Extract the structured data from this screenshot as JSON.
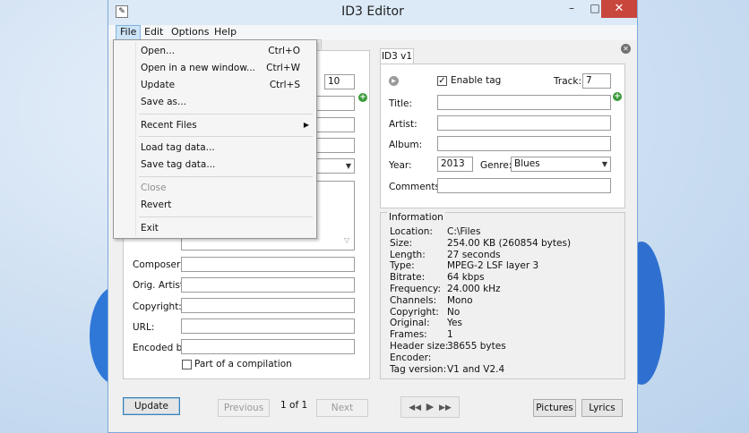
{
  "window": {
    "title": "ID3 Editor"
  },
  "menubar": {
    "file": "File",
    "edit": "Edit",
    "options": "Options",
    "help": "Help"
  },
  "file_menu": {
    "open": {
      "label": "Open...",
      "shortcut": "Ctrl+O"
    },
    "open_new_window": {
      "label": "Open in a new window...",
      "shortcut": "Ctrl+W"
    },
    "update": {
      "label": "Update",
      "shortcut": "Ctrl+S"
    },
    "save_as": {
      "label": "Save as..."
    },
    "recent_files": {
      "label": "Recent Files"
    },
    "load_tag": {
      "label": "Load tag data..."
    },
    "save_tag": {
      "label": "Save tag data..."
    },
    "close": {
      "label": "Close"
    },
    "revert": {
      "label": "Revert"
    },
    "exit": {
      "label": "Exit"
    }
  },
  "left_panel": {
    "track_value": "10",
    "composer_label": "Composer:",
    "orig_artist_label": "Orig. Artist:",
    "copyright_label": "Copyright:",
    "url_label": "URL:",
    "encoded_by_label": "Encoded by:",
    "compilation_label": "Part of a compilation"
  },
  "id3v1": {
    "tab_label": "ID3 v1",
    "enable_tag_label": "Enable tag",
    "track_label": "Track:",
    "track_value": "7",
    "title_label": "Title:",
    "artist_label": "Artist:",
    "album_label": "Album:",
    "year_label": "Year:",
    "year_value": "2013",
    "genre_label": "Genre:",
    "genre_value": "Blues",
    "comments_label": "Comments:"
  },
  "information": {
    "title": "Information",
    "rows": [
      {
        "key": "Location:",
        "value": "C:\\Files"
      },
      {
        "key": "Size:",
        "value": "254.00 KB (260854 bytes)"
      },
      {
        "key": "Length:",
        "value": "27 seconds"
      },
      {
        "key": "Type:",
        "value": "MPEG-2 LSF layer 3"
      },
      {
        "key": "Bitrate:",
        "value": "64 kbps"
      },
      {
        "key": "Frequency:",
        "value": "24.000 kHz"
      },
      {
        "key": "Channels:",
        "value": "Mono"
      },
      {
        "key": "Copyright:",
        "value": "No"
      },
      {
        "key": "Original:",
        "value": "Yes"
      },
      {
        "key": "Frames:",
        "value": "1"
      },
      {
        "key": "Header size:",
        "value": "38655 bytes"
      },
      {
        "key": "Encoder:",
        "value": ""
      },
      {
        "key": "Tag version:",
        "value": "V1 and V2.4"
      }
    ]
  },
  "bottom": {
    "update": "Update",
    "previous": "Previous",
    "pager": "1 of 1",
    "next": "Next",
    "pictures": "Pictures",
    "lyrics": "Lyrics"
  },
  "icons": {
    "app": "pencil-icon",
    "plus": "add-icon",
    "play": "play-icon",
    "close_panel": "close-icon"
  }
}
